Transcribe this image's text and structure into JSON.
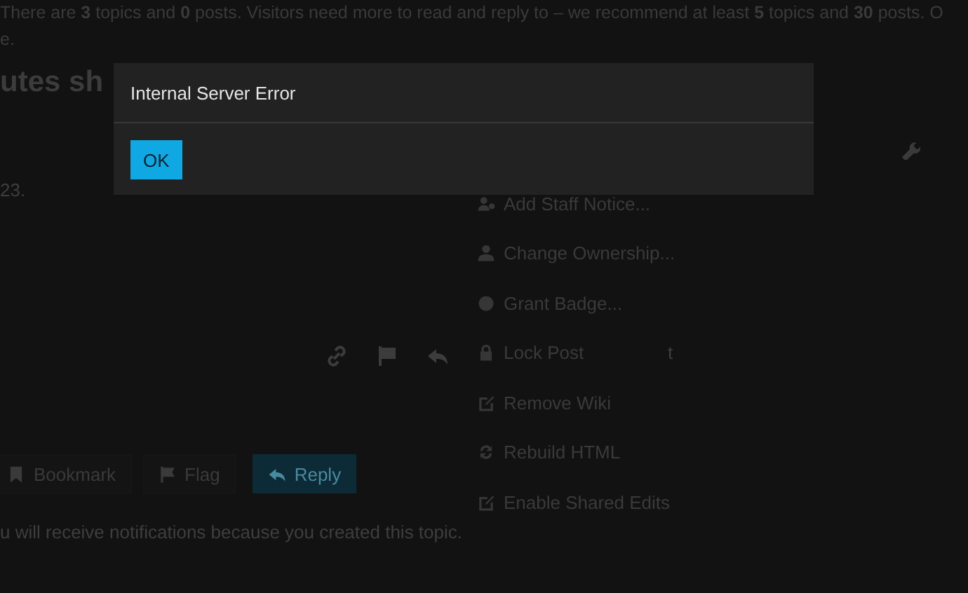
{
  "banner": {
    "lines": [
      "There are **3** topics and **0** posts. Visitors need more to read and reply to – we recommend at least **5** topics and **30** posts. O",
      "e."
    ]
  },
  "topic_title": "utes sh",
  "post": {
    "text": "23.",
    "fragment": "t"
  },
  "admin_menu": {
    "items": [
      {
        "label": "Add Staff Notice..."
      },
      {
        "label": "Change Ownership..."
      },
      {
        "label": "Grant Badge..."
      },
      {
        "label": "Lock Post"
      },
      {
        "label": "Remove Wiki"
      },
      {
        "label": "Rebuild HTML"
      },
      {
        "label": "Enable Shared Edits"
      }
    ]
  },
  "topic_buttons": [
    {
      "label": "Bookmark",
      "kind": "plain"
    },
    {
      "label": "Flag",
      "kind": "plain"
    },
    {
      "label": "Reply",
      "kind": "primary"
    }
  ],
  "notification_text": "u will receive notifications because you created this topic.",
  "dialog": {
    "title": "Internal Server Error",
    "button": "OK"
  }
}
